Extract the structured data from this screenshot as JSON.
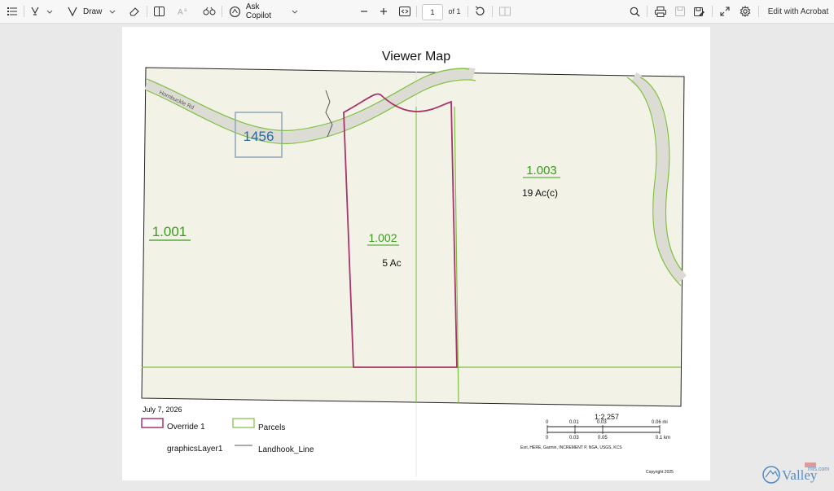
{
  "toolbar": {
    "draw_label": "Draw",
    "copilot_label": "Ask Copilot",
    "page_current": "1",
    "page_of": "of 1",
    "edit_label": "Edit with Acrobat"
  },
  "map": {
    "title": "Viewer Map",
    "road_label": "Hornbuckle Rd",
    "route_badge": "1456",
    "parcels": [
      {
        "id": "1.001",
        "area": ""
      },
      {
        "id": "1.002",
        "area": "5 Ac"
      },
      {
        "id": "1.003",
        "area": "19 Ac(c)"
      }
    ],
    "date": "July 7, 2026",
    "legend": {
      "override": "Override 1",
      "parcels": "Parcels",
      "graphics": "graphicsLayer1",
      "landhook": "Landhook_Line"
    },
    "scale": {
      "ratio": "1:2,257",
      "mi_ticks": [
        "0",
        "0.01",
        "0.03",
        "0.06 mi"
      ],
      "km_ticks": [
        "0",
        "0.03",
        "0.05",
        "0.1 km"
      ],
      "attribution": "Esri, HERE, Garmin, INCREMENT P, NGA, USGS, KCS"
    },
    "copyright": "Copyright 2025"
  },
  "colors": {
    "parcel_line": "#7fbf3f",
    "override": "#a8346c",
    "parcel_label": "#3d9a1e",
    "badge": "#2d6a9a"
  },
  "watermark": {
    "text": "Valley",
    "sub": "mls.com"
  }
}
